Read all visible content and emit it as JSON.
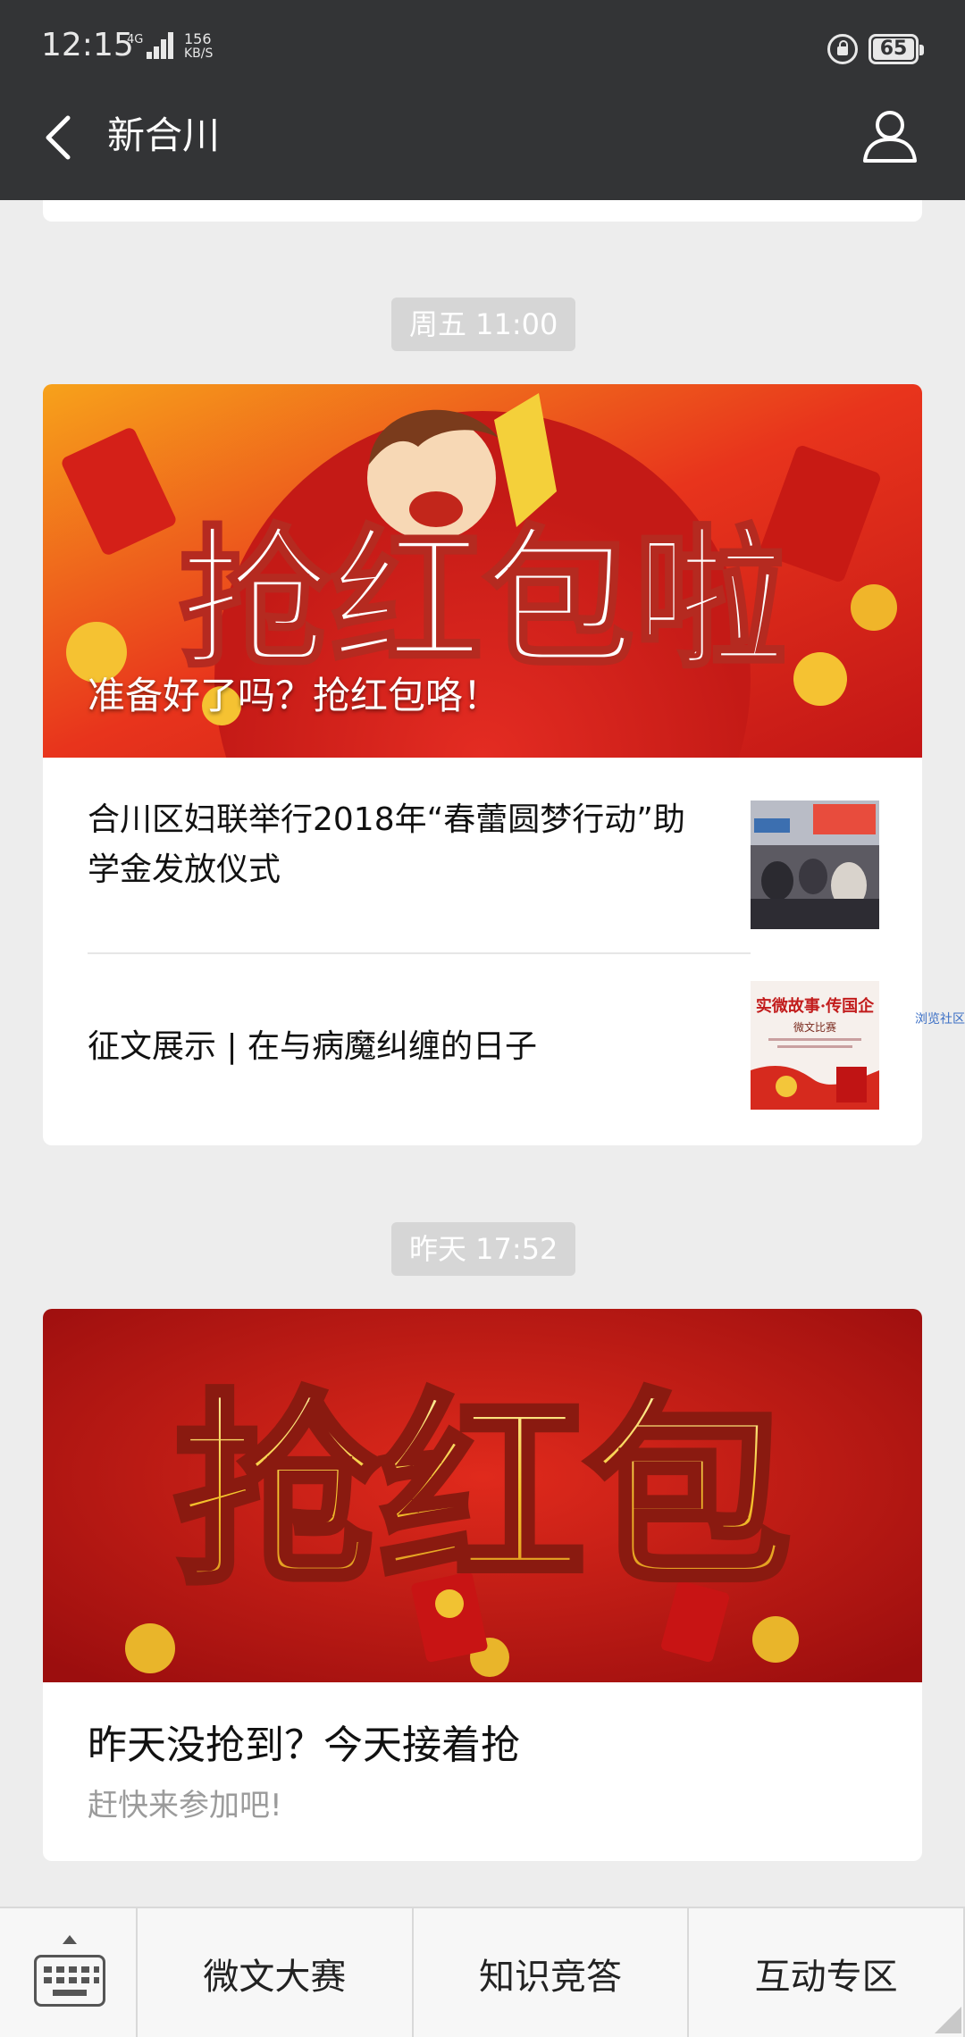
{
  "status_bar": {
    "time": "12:15",
    "network": "4G",
    "speed_value": "156",
    "speed_unit": "KB/S",
    "battery": "65"
  },
  "nav": {
    "title": "新合川"
  },
  "messages": [
    {
      "timestamp": "周五 11:00",
      "banner_caption": "准备好了吗？抢红包咯！",
      "banner_art_text": "抢红包啦",
      "sub_articles": [
        {
          "title": "合川区妇联举行2018年“春蕾圆梦行动”助学金发放仪式"
        },
        {
          "title": "征文展示 | 在与病魔纠缠的日子"
        }
      ]
    },
    {
      "timestamp": "昨天 17:52",
      "banner_art_text": "抢红包",
      "title": "昨天没抢到？今天接着抢",
      "description": "赶快来参加吧!"
    }
  ],
  "thumb2_text": {
    "line1": "实微故事·传国企",
    "line2": "微文比赛"
  },
  "side_link": "浏览社区",
  "bottom_menu": {
    "items": [
      "微文大赛",
      "知识竞答",
      "互动专区"
    ]
  }
}
